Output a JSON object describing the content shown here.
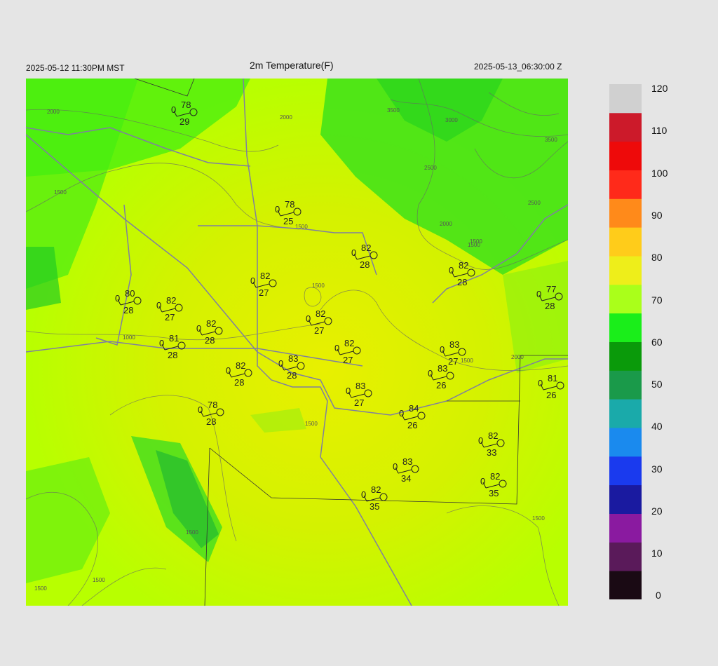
{
  "header": {
    "title": "2m Temperature(F)",
    "valid_local": "2025-05-12 11:30PM MST",
    "valid_utc": "2025-05-13_06:30:00 Z"
  },
  "colorbar": {
    "ticks": [
      "120",
      "110",
      "100",
      "90",
      "80",
      "70",
      "60",
      "50",
      "40",
      "30",
      "20",
      "10",
      "0"
    ],
    "colors": [
      "#1a0a14",
      "#5a1a5a",
      "#8a1aa0",
      "#1a1aa0",
      "#1a3aee",
      "#1a8aee",
      "#1aaaaa",
      "#1a9a4a",
      "#0a9a0a",
      "#1aee1a",
      "#aaff1a",
      "#eeee1a",
      "#ffcc1a",
      "#ff8a1a",
      "#ff2a1a",
      "#ee0a0a",
      "#cc1a2a",
      "#d0d0d0"
    ]
  },
  "map": {
    "contour_labels": [
      "2000",
      "2000",
      "1500",
      "1500",
      "3500",
      "3000",
      "3500",
      "2500",
      "2500",
      "2000",
      "1500",
      "1500",
      "1500",
      "1000",
      "1500",
      "2000",
      "1500",
      "1500",
      "1500",
      "1500",
      "1500"
    ],
    "stations": [
      {
        "t": "78",
        "d": "29",
        "w": "0"
      },
      {
        "t": "78",
        "d": "25",
        "w": "0"
      },
      {
        "t": "82",
        "d": "28",
        "w": "0"
      },
      {
        "t": "82",
        "d": "28",
        "w": "0"
      },
      {
        "t": "82",
        "d": "27",
        "w": "0"
      },
      {
        "t": "80",
        "d": "28",
        "w": "0"
      },
      {
        "t": "82",
        "d": "27",
        "w": "0"
      },
      {
        "t": "77",
        "d": "28",
        "w": "0"
      },
      {
        "t": "82",
        "d": "27",
        "w": "0"
      },
      {
        "t": "82",
        "d": "28",
        "w": "0"
      },
      {
        "t": "81",
        "d": "28",
        "w": "0"
      },
      {
        "t": "82",
        "d": "27",
        "w": "0"
      },
      {
        "t": "83",
        "d": "28",
        "w": "0"
      },
      {
        "t": "83",
        "d": "27",
        "w": "0"
      },
      {
        "t": "82",
        "d": "28",
        "w": "0"
      },
      {
        "t": "83",
        "d": "26",
        "w": "0"
      },
      {
        "t": "81",
        "d": "26",
        "w": "0"
      },
      {
        "t": "83",
        "d": "27",
        "w": "0"
      },
      {
        "t": "78",
        "d": "28",
        "w": "0"
      },
      {
        "t": "84",
        "d": "26",
        "w": "0"
      },
      {
        "t": "82",
        "d": "33",
        "w": "0"
      },
      {
        "t": "83",
        "d": "34",
        "w": "0"
      },
      {
        "t": "82",
        "d": "35",
        "w": "0"
      },
      {
        "t": "82",
        "d": "35",
        "w": "0"
      }
    ]
  }
}
